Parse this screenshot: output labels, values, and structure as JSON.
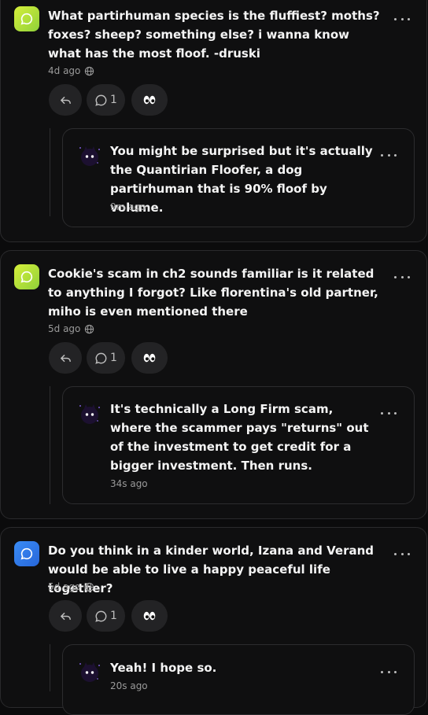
{
  "posts": [
    {
      "avatar_color": "#b6e134",
      "question": "What partirhuman species is the fluffiest? moths? foxes? sheep? something else? i wanna know what has the most floof. -druski",
      "time": "4d ago",
      "comment_count": "1",
      "reply": {
        "text": "You might be surprised but it's actually the Quantirian Floofer, a dog partirhuman that is 90% floof by volume.",
        "time": "9m ago"
      }
    },
    {
      "avatar_color": "#b6e134",
      "question": "Cookie's scam in ch2 sounds familiar is it related to anything I forgot? Like florentina's old partner, miho is even mentioned there",
      "time": "5d ago",
      "comment_count": "1",
      "reply": {
        "text": "It's technically a Long Firm scam, where the scammer pays \"returns\" out of the investment to get credit for a bigger investment. Then runs.",
        "time": "34s ago"
      }
    },
    {
      "avatar_color": "#2f7bf2",
      "question": "Do you think in a kinder world, Izana and Verand would be able to live a happy peaceful life together?",
      "time": "5d ago",
      "comment_count": "1",
      "reply": {
        "text": "Yeah! I hope so.",
        "time": "20s ago"
      }
    }
  ],
  "icons": {
    "avatar": "speech-bubble-icon",
    "visibility": "globe-icon",
    "reply": "reply-arrow-icon",
    "comments": "comment-icon",
    "reaction": "eyes-icon",
    "menu": "more-dots-icon"
  }
}
